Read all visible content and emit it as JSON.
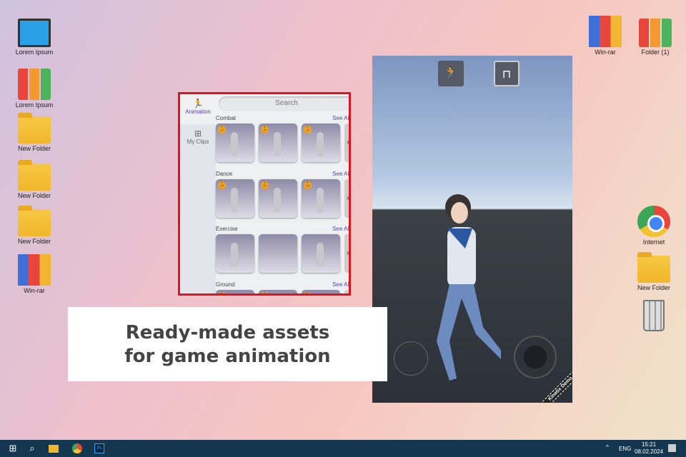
{
  "desktop_left": [
    {
      "label": "Lorem Ipsum",
      "icon": "computer-icon"
    },
    {
      "label": "Lorem Ipsum",
      "icon": "binders-icon"
    },
    {
      "label": "New Folder",
      "icon": "folder-icon"
    },
    {
      "label": "New Folder",
      "icon": "folder-icon"
    },
    {
      "label": "New Folder",
      "icon": "folder-icon"
    },
    {
      "label": "Win-rar",
      "icon": "winrar-icon"
    }
  ],
  "desktop_right": [
    {
      "label": "Win-rar"
    },
    {
      "label": "Folder (1)"
    },
    {
      "label": "Internet"
    },
    {
      "label": "New Folder"
    },
    {
      "label": "Recycle Bin"
    }
  ],
  "panel": {
    "tabs": [
      {
        "label": "Animation",
        "icon": "running-person-icon"
      },
      {
        "label": "My Clips",
        "icon": "grid-icon"
      }
    ],
    "search_placeholder": "Search",
    "see_all": "See All",
    "categories": [
      {
        "name": "Combat"
      },
      {
        "name": "Dance"
      },
      {
        "name": "Exercise"
      },
      {
        "name": "Ground"
      }
    ]
  },
  "game": {
    "watermark": "Kinetix Demo"
  },
  "caption": {
    "line1": "Ready-made assets",
    "line2": "for game animation"
  },
  "taskbar": {
    "lang": "ENG",
    "time": "15:21",
    "date": "08.02.2024"
  }
}
